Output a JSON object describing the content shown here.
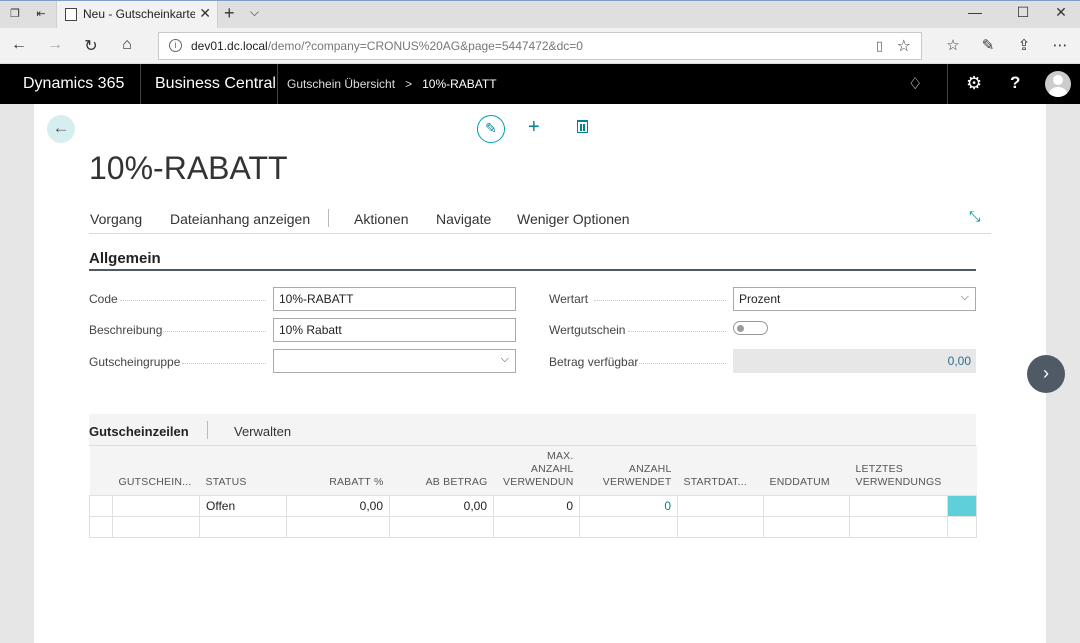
{
  "browser": {
    "tab_title": "Neu - Gutscheinkarte -",
    "url_host": "dev01.dc.local",
    "url_path": "/demo/?company=CRONUS%20AG&page=5447472&dc=0"
  },
  "appbar": {
    "product": "Dynamics 365",
    "app": "Business Central",
    "breadcrumb_parent": "Gutschein Übersicht",
    "breadcrumb_sep": ">",
    "breadcrumb_current": "10%-RABATT"
  },
  "page": {
    "title": "10%-RABATT"
  },
  "actions": {
    "vorgang": "Vorgang",
    "dateianhang": "Dateianhang anzeigen",
    "aktionen": "Aktionen",
    "navigate": "Navigate",
    "weniger": "Weniger Optionen"
  },
  "general": {
    "section_title": "Allgemein",
    "code_label": "Code",
    "code_value": "10%-RABATT",
    "beschreibung_label": "Beschreibung",
    "beschreibung_value": "10% Rabatt",
    "gruppe_label": "Gutscheingruppe",
    "gruppe_value": "",
    "wertart_label": "Wertart",
    "wertart_value": "Prozent",
    "wertgutschein_label": "Wertgutschein",
    "wertgutschein_on": false,
    "betrag_label": "Betrag verfügbar",
    "betrag_value": "0,00"
  },
  "lines": {
    "title": "Gutscheinzeilen",
    "verwalten": "Verwalten",
    "columns": [
      "",
      "GUTSCHEIN...",
      "STATUS",
      "RABATT %",
      "AB BETRAG",
      "MAX. ANZAHL VERWENDUN",
      "ANZAHL VERWENDET",
      "STARTDAT...",
      "ENDDATUM",
      "LETZTES VERWENDUNGS",
      ""
    ],
    "col_max_1": "MAX.",
    "col_max_2": "ANZAHL",
    "col_max_3": "VERWENDUN",
    "col_anz_1": "ANZAHL",
    "col_anz_2": "VERWENDET",
    "col_letzt_1": "LETZTES",
    "col_letzt_2": "VERWENDUNGS",
    "rows": [
      {
        "gutschein": "",
        "status": "Offen",
        "rabatt": "0,00",
        "ab_betrag": "0,00",
        "max_anzahl": "0",
        "anzahl_verwendet": "0",
        "startdatum": "",
        "enddatum": "",
        "letztes": ""
      }
    ]
  }
}
